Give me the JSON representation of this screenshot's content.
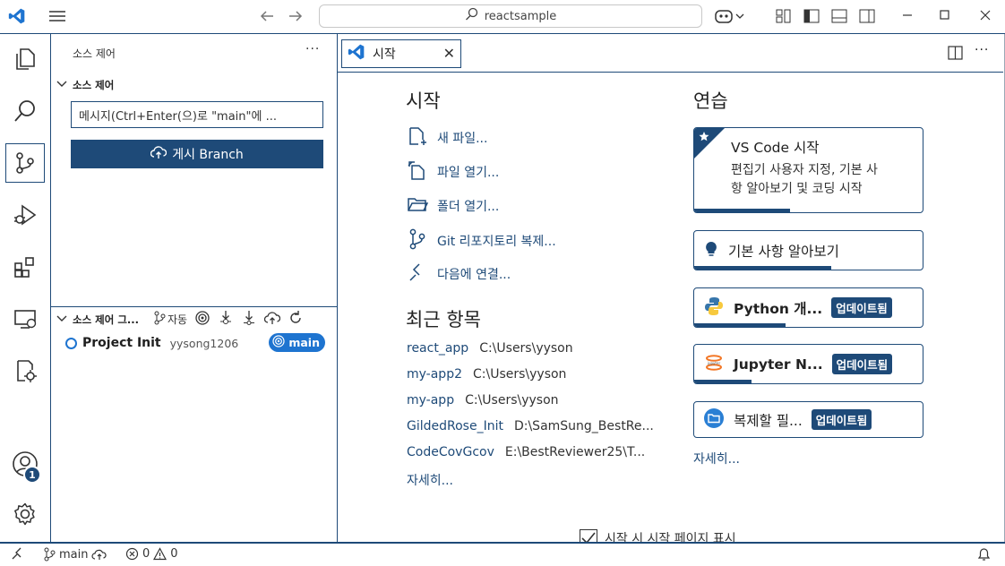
{
  "titlebar": {
    "search_text": "reactsample"
  },
  "activity": {
    "account_badge": "1"
  },
  "sidebar": {
    "title": "소스 제어",
    "section_title": "소스 제어",
    "message_placeholder": "메시지(Ctrl+Enter(으)로 \"main\"에 ...",
    "publish_label": "게시 Branch",
    "graph_title": "소스 제어 그...",
    "graph_auto_label": "자동",
    "commit": {
      "message": "Project Init",
      "author": "yysong1206",
      "branch": "main"
    }
  },
  "tabs": [
    {
      "label": "시작"
    }
  ],
  "welcome": {
    "start_heading": "시작",
    "start_items": [
      {
        "label": "새 파일..."
      },
      {
        "label": "파일 열기..."
      },
      {
        "label": "폴더 열기..."
      },
      {
        "label": "Git 리포지토리 복제..."
      },
      {
        "label": "다음에 연결..."
      }
    ],
    "recent_heading": "최근 항목",
    "recent": [
      {
        "name": "react_app",
        "path": "C:\\Users\\yyson"
      },
      {
        "name": "my-app2",
        "path": "C:\\Users\\yyson"
      },
      {
        "name": "my-app",
        "path": "C:\\Users\\yyson"
      },
      {
        "name": "GildedRose_Init",
        "path": "D:\\SamSung_BestRe..."
      },
      {
        "name": "CodeCovGcov",
        "path": "E:\\BestReviewer25\\T..."
      }
    ],
    "recent_more": "자세히...",
    "walk_heading": "연습",
    "featured": {
      "title": "VS Code 시작",
      "desc_line1": "편집기 사용자 지정, 기본 사",
      "desc_line2": "항 알아보기 및 코딩 시작",
      "progress": 0.42
    },
    "walkthroughs": [
      {
        "title": "기본 사항 알아보기",
        "badge": "",
        "progress": 0.6
      },
      {
        "title": "Python 개...",
        "badge": "업데이트됨",
        "progress": 0.4
      },
      {
        "title": "Jupyter N...",
        "badge": "업데이트됨",
        "progress": 0.25
      },
      {
        "title": "복제할 필...",
        "badge": "업데이트됨",
        "progress": 0.0
      }
    ],
    "walk_more": "자세히...",
    "show_on_startup": "시작 시 시작 페이지 표시"
  },
  "statusbar": {
    "branch": "main",
    "errors": "0",
    "warnings": "0"
  },
  "colors": {
    "accent": "#1e4a78",
    "branch_pill": "#1e74d0"
  }
}
